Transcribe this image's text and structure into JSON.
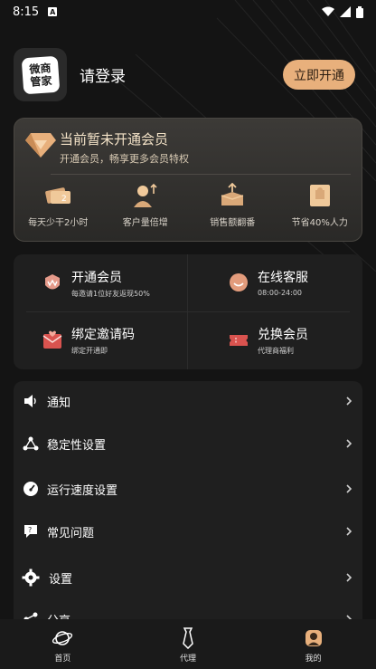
{
  "status_bar": {
    "time": "8:15",
    "app_badge": "A"
  },
  "header": {
    "logo_text_line1": "微商",
    "logo_text_line2": "管家",
    "login_label": "请登录",
    "open_button": "立即开通"
  },
  "vip_card": {
    "title": "当前暂未开通会员",
    "subtitle": "开通会员，畅享更多会员特权",
    "perks": [
      {
        "label": "每天少干2小时",
        "icon": "ticket-icon"
      },
      {
        "label": "客户量倍增",
        "icon": "customers-up-icon"
      },
      {
        "label": "销售额翻番",
        "icon": "sales-box-icon"
      },
      {
        "label": "节省40%人力",
        "icon": "puzzle-icon"
      }
    ]
  },
  "quick": {
    "open_member": {
      "title": "开通会员",
      "sub": "每邀请1位好友返现50%"
    },
    "service": {
      "title": "在线客服",
      "sub": "08:00-24:00"
    },
    "invite": {
      "title": "绑定邀请码",
      "sub": "绑定开通即"
    },
    "redeem": {
      "title": "兑换会员",
      "sub": "代理商福利"
    }
  },
  "menu": [
    {
      "label": "通知",
      "icon": "speaker-icon"
    },
    {
      "label": "稳定性设置",
      "icon": "network-icon"
    },
    {
      "label": "运行速度设置",
      "icon": "speedometer-icon"
    },
    {
      "label": "常见问题",
      "icon": "faq-icon"
    },
    {
      "label": "设置",
      "icon": "gear-icon"
    },
    {
      "label": "分享",
      "icon": "share-icon"
    }
  ],
  "bottom_nav": [
    {
      "label": "首页",
      "icon": "planet-icon"
    },
    {
      "label": "代理",
      "icon": "tie-icon"
    },
    {
      "label": "我的",
      "icon": "person-icon"
    }
  ],
  "colors": {
    "accent": "#e8b07c",
    "background": "#141414",
    "card": "#1f1f1f",
    "vip_card": "#35332f",
    "icon_red": "#d9534f"
  }
}
